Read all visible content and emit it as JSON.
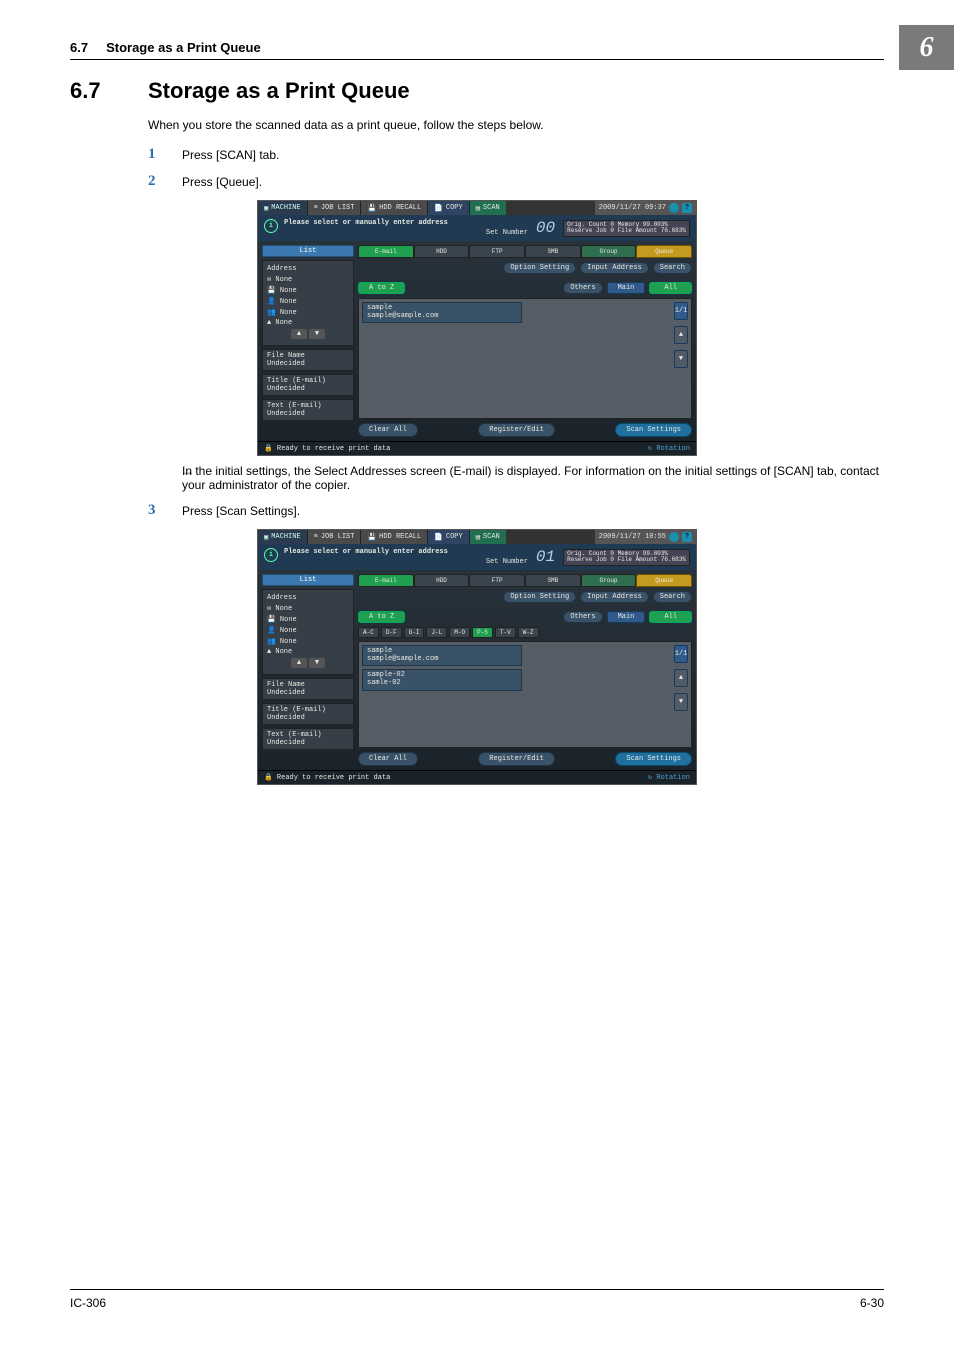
{
  "header": {
    "num": "6.7",
    "title": "Storage as a Print Queue"
  },
  "chapter_badge": "6",
  "section": {
    "num": "6.7",
    "title": "Storage as a Print Queue"
  },
  "intro": "When you store the scanned data as a print queue, follow the steps below.",
  "steps": {
    "s1": {
      "num": "1",
      "text": "Press [SCAN] tab."
    },
    "s2": {
      "num": "2",
      "text": "Press [Queue]."
    },
    "s3": {
      "num": "3",
      "text": "Press [Scan Settings]."
    }
  },
  "note_arrow": "→",
  "note_text": "In the initial settings, the Select Addresses screen (E-mail) is displayed.  For information on the initial settings of [SCAN] tab, contact your administrator of the copier.",
  "shot": {
    "top": {
      "machine": "MACHINE",
      "joblist": "JOB LIST",
      "hddrecall": "HDD RECALL",
      "copy": "COPY",
      "scan": "SCAN",
      "qmark": "?"
    },
    "msg": "Please select or manually enter address",
    "set_number": "Set Number",
    "stat": {
      "l1a": "Orig. Count",
      "l1b": "0",
      "l1c": "Memory",
      "l1d": "99.803%",
      "l2a": "Reserve Job",
      "l2b": "0",
      "l2c": "File Amount",
      "l2d": "76.683%"
    },
    "left": {
      "list": "List",
      "address": "Address",
      "none": "None",
      "arrows": {
        "up": "▲",
        "down": "▼"
      },
      "file_name": "File Name",
      "title": "Title (E-mail)",
      "text": "Text (E-mail)",
      "undecided": "Undecided"
    },
    "tabs": {
      "email": "E-mail",
      "hdd": "HDD",
      "ftp": "FTP",
      "smb": "SMB",
      "group": "Group",
      "queue": "Queue"
    },
    "subrow": {
      "option": "Option Setting",
      "input": "Input Address",
      "search": "Search",
      "atoz": "A to Z",
      "others": "Others",
      "main": "Main",
      "all": "All"
    },
    "alpha": [
      "A-C",
      "D-F",
      "G-I",
      "J-L",
      "M-O",
      "P-S",
      "T-V",
      "W-Z"
    ],
    "entry1": {
      "name": "sample",
      "addr": "sample@sample.com"
    },
    "entry2": {
      "name": "sample-02",
      "addr": "samle-02"
    },
    "scroll": {
      "count": "1",
      "total": "1",
      "up": "▲",
      "down": "▼"
    },
    "bottom": {
      "clear": "Clear All",
      "regedit": "Register/Edit",
      "scanset": "Scan Settings"
    },
    "status": {
      "ready": "Ready to receive print data",
      "rot": "Rotation"
    },
    "time1": "2009/11/27  09:37",
    "time2": "2009/11/27  10:55",
    "digital1": "00",
    "digital2": "01"
  },
  "footer": {
    "left": "IC-306",
    "right": "6-30"
  }
}
